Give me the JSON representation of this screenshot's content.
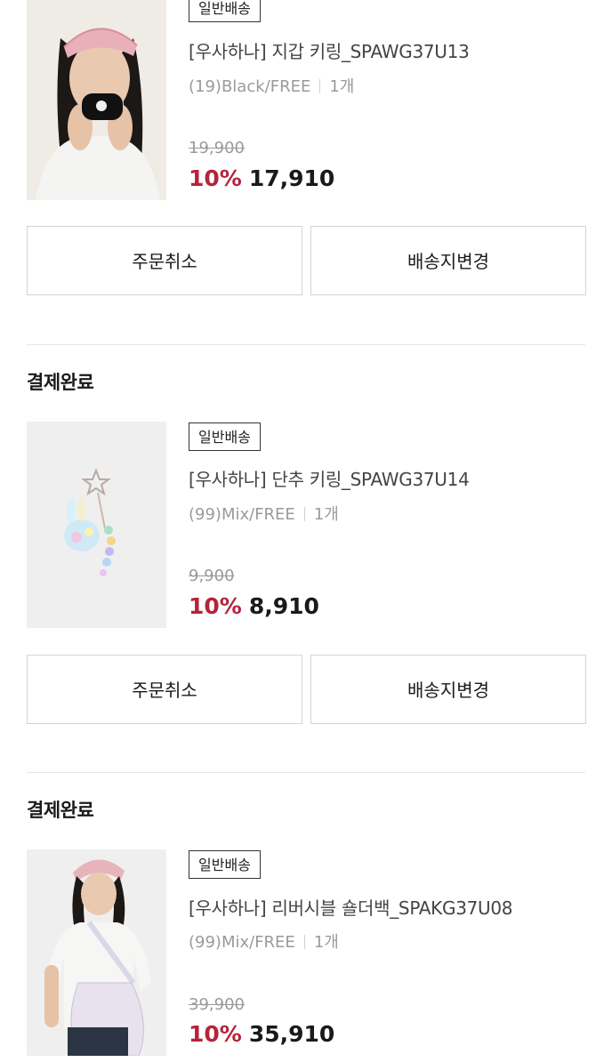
{
  "orders": [
    {
      "status": "",
      "product": {
        "badge": "일반배송",
        "name": "[우사하나] 지갑 키링_SPAWG37U13",
        "option": "(19)Black/FREE",
        "quantity": "1개",
        "original_price": "19,900",
        "discount": "10%",
        "final_price": "17,910",
        "image": "model-with-wallet-keyring-photo"
      },
      "buttons": {
        "cancel": "주문취소",
        "change_address": "배송지변경"
      }
    },
    {
      "status": "결제완료",
      "product": {
        "badge": "일반배송",
        "name": "[우사하나] 단추 키링_SPAWG37U14",
        "option": "(99)Mix/FREE",
        "quantity": "1개",
        "original_price": "9,900",
        "discount": "10%",
        "final_price": "8,910",
        "image": "button-keyring-photo"
      },
      "buttons": {
        "cancel": "주문취소",
        "change_address": "배송지변경"
      }
    },
    {
      "status": "결제완료",
      "product": {
        "badge": "일반배송",
        "name": "[우사하나] 리버시블 숄더백_SPAKG37U08",
        "option": "(99)Mix/FREE",
        "quantity": "1개",
        "original_price": "39,900",
        "discount": "10%",
        "final_price": "35,910",
        "image": "model-with-shoulder-bag-photo"
      }
    }
  ],
  "colors": {
    "discount": "#b4243a",
    "muted": "#9a9a9a",
    "border": "#d4d4d4"
  }
}
